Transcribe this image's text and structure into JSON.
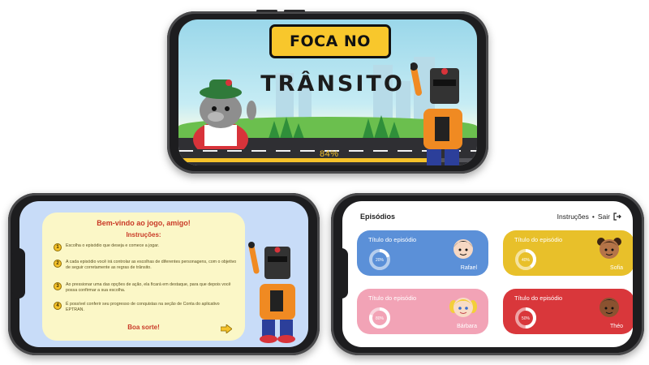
{
  "splash": {
    "logo_line1": "FOCA NO",
    "logo_line2": "TRÂNSITO",
    "progress_label": "84%",
    "progress": 0.84
  },
  "welcome": {
    "title": "Bem-vindo ao jogo, amigo!",
    "subtitle": "Instruções:",
    "steps": [
      {
        "num": "1",
        "text": "Escolha o episódio que deseja e comece a jogar."
      },
      {
        "num": "2",
        "text": "A cada episódio você irá controlar as escolhas de diferentes personagens, com o objetivo de seguir corretamente as regras de trânsito."
      },
      {
        "num": "3",
        "text": "Ao pressionar uma das opções de ação, ela ficará em destaque, para que depois você possa confirmar a sua escolha."
      },
      {
        "num": "4",
        "text": "É possível conferir seu progresso de conquistas na seção de Conta do aplicativo EPTRAN."
      }
    ],
    "closing": "Boa sorte!"
  },
  "episodes": {
    "title": "Episódios",
    "nav_instructions": "Instruções",
    "nav_separator": "•",
    "nav_exit": "Sair",
    "cards": [
      {
        "title": "Título do episódio",
        "name": "Rafael",
        "percent_label": "20%",
        "percent": 0.2,
        "color": "#5b90d8"
      },
      {
        "title": "Título do episódio",
        "name": "Sofia",
        "percent_label": "40%",
        "percent": 0.4,
        "color": "#e8c02a"
      },
      {
        "title": "Título do episódio",
        "name": "Bárbara",
        "percent_label": "80%",
        "percent": 0.8,
        "color": "#f2a3b6"
      },
      {
        "title": "Título do episódio",
        "name": "Théo",
        "percent_label": "50%",
        "percent": 0.5,
        "color": "#d9373b"
      }
    ]
  },
  "colors": {
    "yellow": "#f5c22a",
    "red_text": "#c93a27",
    "welcome_bg": "#c8dcf8",
    "card_cream": "#fbf7c7"
  }
}
